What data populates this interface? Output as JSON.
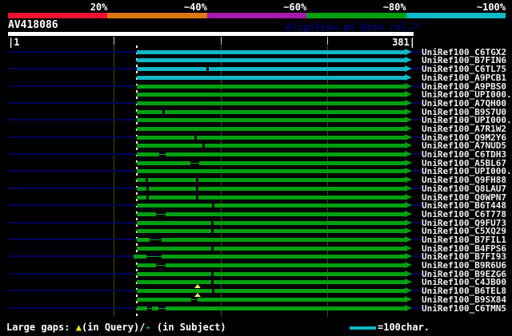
{
  "header": {
    "identity_scale": [
      {
        "label": "20%",
        "color": "#ee1230"
      },
      {
        "label": "~40%",
        "color": "#dd7711"
      },
      {
        "label": "~60%",
        "color": "#a519ad"
      },
      {
        "label": "~80%",
        "color": "#00a010"
      },
      {
        "label": "~100%",
        "color": "#10b8c8"
      }
    ],
    "query_name": "AV418086",
    "watermark": "AlignView.pm Beta rel.7",
    "ruler": {
      "start_label": "|1",
      "end_label": "381|",
      "min": 1,
      "max": 381,
      "ticks": [
        100,
        200,
        300
      ]
    }
  },
  "legend": {
    "large_gaps_prefix": "Large gaps: ",
    "query_marker": "▲",
    "query_text": "(in Query)/",
    "subject_marker": "-",
    "subject_text": " (in Subject)",
    "scale_bar_text": "=100char."
  },
  "chart_data": {
    "type": "alignment-hit-map",
    "title": "AV418086",
    "query_length": 381,
    "x_axis": {
      "min": 1,
      "max": 381,
      "gridlines": [
        100,
        200,
        300
      ]
    },
    "common_hit_start": 122,
    "identity_colors": {
      "cyan": "#10b8c8",
      "green": "#00a010"
    },
    "identity_legend": {
      "cyan": "~100%",
      "green": "~80%"
    },
    "rows": [
      {
        "label": "UniRef100_C6TGX2",
        "color": "cyan",
        "segments": [
          [
            122,
            373
          ]
        ],
        "notches": [],
        "triangles": []
      },
      {
        "label": "UniRef100_B7FIN6",
        "color": "cyan",
        "segments": [
          [
            122,
            373
          ]
        ],
        "notches": [],
        "triangles": []
      },
      {
        "label": "UniRef100_C6TL75",
        "color": "cyan",
        "segments": [
          [
            122,
            373
          ]
        ],
        "notches": [
          187
        ],
        "triangles": []
      },
      {
        "label": "UniRef100_A9PCB1",
        "color": "cyan",
        "segments": [
          [
            122,
            373
          ]
        ],
        "notches": [],
        "triangles": []
      },
      {
        "label": "UniRef100_A9PBS0",
        "color": "green",
        "segments": [
          [
            122,
            373
          ]
        ],
        "notches": [],
        "triangles": []
      },
      {
        "label": "UniRef100_UPI000..",
        "color": "green",
        "segments": [
          [
            122,
            373
          ]
        ],
        "notches": [],
        "triangles": []
      },
      {
        "label": "UniRef100_A7QH00",
        "color": "green",
        "segments": [
          [
            122,
            373
          ]
        ],
        "notches": [],
        "triangles": []
      },
      {
        "label": "UniRef100_B9S7U0",
        "color": "green",
        "segments": [
          [
            122,
            373
          ]
        ],
        "notches": [
          146
        ],
        "triangles": []
      },
      {
        "label": "UniRef100_UPI000..",
        "color": "green",
        "segments": [
          [
            122,
            373
          ]
        ],
        "notches": [],
        "triangles": []
      },
      {
        "label": "UniRef100_A7R1W2",
        "color": "green",
        "segments": [
          [
            122,
            373
          ]
        ],
        "notches": [],
        "triangles": []
      },
      {
        "label": "UniRef100_Q9M2Y6",
        "color": "green",
        "segments": [
          [
            122,
            373
          ]
        ],
        "notches": [
          176
        ],
        "triangles": []
      },
      {
        "label": "UniRef100_A7NUD5",
        "color": "green",
        "segments": [
          [
            122,
            373
          ]
        ],
        "notches": [
          183
        ],
        "triangles": []
      },
      {
        "label": "UniRef100_C6TDH3",
        "color": "green",
        "segments": [
          [
            122,
            143
          ],
          [
            149,
            373
          ]
        ],
        "notches": [],
        "triangles": []
      },
      {
        "label": "UniRef100_A5BL67",
        "color": "green",
        "segments": [
          [
            122,
            172
          ],
          [
            180,
            373
          ]
        ],
        "notches": [],
        "triangles": []
      },
      {
        "label": "UniRef100_UPI000..",
        "color": "green",
        "segments": [
          [
            122,
            373
          ]
        ],
        "notches": [],
        "triangles": []
      },
      {
        "label": "UniRef100_Q9FH88",
        "color": "green",
        "segments": [
          [
            122,
            373
          ]
        ],
        "notches": [
          130,
          177
        ],
        "triangles": []
      },
      {
        "label": "UniRef100_Q8LAU7",
        "color": "green",
        "segments": [
          [
            122,
            373
          ]
        ],
        "notches": [
          131,
          177
        ],
        "triangles": []
      },
      {
        "label": "UniRef100_Q0WPN7",
        "color": "green",
        "segments": [
          [
            122,
            373
          ]
        ],
        "notches": [
          131,
          177
        ],
        "triangles": []
      },
      {
        "label": "UniRef100_B6T448",
        "color": "green",
        "segments": [
          [
            122,
            373
          ]
        ],
        "notches": [
          192
        ],
        "triangles": []
      },
      {
        "label": "UniRef100_C6T778",
        "color": "green",
        "segments": [
          [
            122,
            140
          ],
          [
            149,
            373
          ]
        ],
        "notches": [],
        "triangles": []
      },
      {
        "label": "UniRef100_Q9FU73",
        "color": "green",
        "segments": [
          [
            122,
            373
          ]
        ],
        "notches": [
          191
        ],
        "triangles": []
      },
      {
        "label": "UniRef100_C5XQ29",
        "color": "green",
        "segments": [
          [
            122,
            373
          ]
        ],
        "notches": [
          191
        ],
        "triangles": []
      },
      {
        "label": "UniRef100_B7FIL1",
        "color": "green",
        "segments": [
          [
            122,
            134
          ],
          [
            145,
            373
          ]
        ],
        "notches": [],
        "triangles": []
      },
      {
        "label": "UniRef100_B4FPS6",
        "color": "green",
        "segments": [
          [
            122,
            373
          ]
        ],
        "notches": [
          191
        ],
        "triangles": []
      },
      {
        "label": "UniRef100_B7FI93",
        "color": "green",
        "segments": [
          [
            119,
            131
          ],
          [
            145,
            373
          ]
        ],
        "notches": [],
        "triangles": []
      },
      {
        "label": "UniRef100_B9R6U6",
        "color": "green",
        "segments": [
          [
            122,
            140
          ],
          [
            149,
            373
          ]
        ],
        "notches": [],
        "triangles": []
      },
      {
        "label": "UniRef100_B9EZG6",
        "color": "green",
        "segments": [
          [
            122,
            373
          ]
        ],
        "notches": [
          191
        ],
        "triangles": []
      },
      {
        "label": "UniRef100_C4JB00",
        "color": "green",
        "segments": [
          [
            122,
            373
          ]
        ],
        "notches": [
          191
        ],
        "triangles": []
      },
      {
        "label": "UniRef100_B6TEL8",
        "color": "green",
        "segments": [
          [
            122,
            373
          ]
        ],
        "notches": [
          192
        ],
        "triangles": [
          179
        ]
      },
      {
        "label": "UniRef100_B9SX84",
        "color": "green",
        "segments": [
          [
            122,
            173
          ],
          [
            179,
            373
          ]
        ],
        "notches": [],
        "triangles": [
          179
        ]
      },
      {
        "label": "UniRef100_C6TMN5",
        "color": "green",
        "segments": [
          [
            122,
            132
          ],
          [
            136,
            142
          ],
          [
            149,
            373
          ]
        ],
        "notches": [],
        "triangles": []
      }
    ],
    "arrow_tip": 381,
    "scale_bar_chars": 100
  }
}
